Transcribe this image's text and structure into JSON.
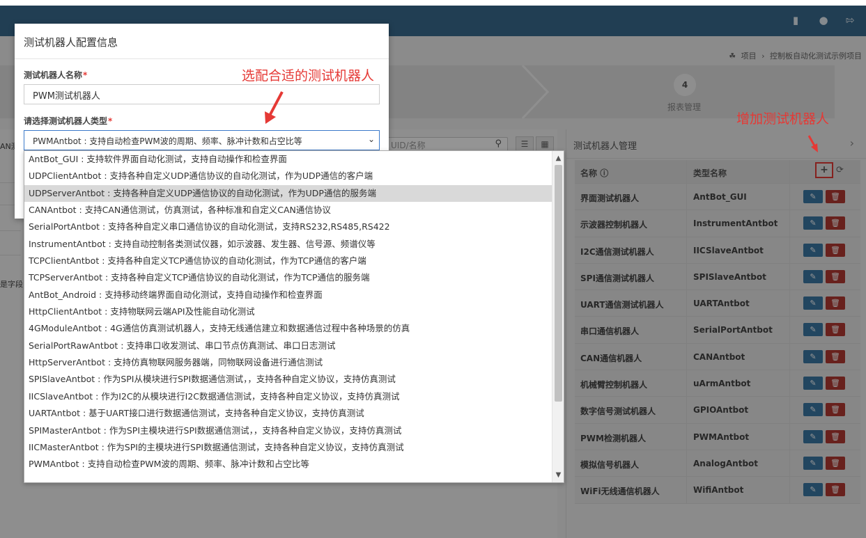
{
  "colors": {
    "topbar": "#3a6c8f",
    "accent_red": "#e53935",
    "edit_btn": "#3b79a6",
    "delete_btn": "#b33a32",
    "selected_option": "#d9d9d9"
  },
  "topbar": {
    "icons": [
      "file-icon",
      "user-icon",
      "logout-icon"
    ]
  },
  "breadcrumb": {
    "home": "项目",
    "sep": "›",
    "current": "控制板自动化测试示例项目"
  },
  "wizard": {
    "step_number": "4",
    "step_label": "报表管理"
  },
  "left_fragments": {
    "frag1": "AN测",
    "frag2": "是字段"
  },
  "search": {
    "placeholder": "UID/名称"
  },
  "right_panel": {
    "title": "测试机器人管理",
    "header": {
      "name": "名称",
      "type": "类型名称"
    },
    "rows": [
      {
        "name": "界面测试机器人",
        "type": "AntBot_GUI"
      },
      {
        "name": "示波器控制机器人",
        "type": "InstrumentAntbot"
      },
      {
        "name": "I2C通信测试机器人",
        "type": "IICSlaveAntbot"
      },
      {
        "name": "SPI通信测试机器人",
        "type": "SPISlaveAntbot"
      },
      {
        "name": "UART通信测试机器人",
        "type": "UARTAntbot"
      },
      {
        "name": "串口通信机器人",
        "type": "SerialPortAntbot"
      },
      {
        "name": "CAN通信机器人",
        "type": "CANAntbot"
      },
      {
        "name": "机械臂控制机器人",
        "type": "uArmAntbot"
      },
      {
        "name": "数字信号测试机器人",
        "type": "GPIOAntbot"
      },
      {
        "name": "PWM检测机器人",
        "type": "PWMAntbot"
      },
      {
        "name": "模拟信号机器人",
        "type": "AnalogAntbot"
      },
      {
        "name": "WiFi无线通信机器人",
        "type": "WifiAntbot"
      }
    ]
  },
  "modal": {
    "title": "测试机器人配置信息",
    "name_label": "测试机器人名称",
    "name_value": "PWM测试机器人",
    "type_label": "请选择测试机器人类型",
    "required_mark": "*",
    "selected_type": "PWMAntbot : 支持自动检查PWM波的周期、频率、脉冲计数和占空比等"
  },
  "dropdown": {
    "options": [
      "AntBot_GUI : 支持软件界面自动化测试，支持自动操作和检查界面",
      "UDPClientAntbot : 支持各种自定义UDP通信协议的自动化测试，作为UDP通信的客户端",
      "UDPServerAntbot : 支持各种自定义UDP通信协议的自动化测试，作为UDP通信的服务端",
      "CANAntbot : 支持CAN通信测试，仿真测试，各种标准和自定义CAN通信协议",
      "SerialPortAntbot : 支持各种自定义串口通信协议的自动化测试，支持RS232,RS485,RS422",
      "InstrumentAntbot : 支持自动控制各类测试仪器，如示波器、发生器、信号源、频谱仪等",
      "TCPClientAntbot : 支持各种自定义TCP通信协议的自动化测试，作为TCP通信的客户端",
      "TCPServerAntbot : 支持各种自定义TCP通信协议的自动化测试，作为TCP通信的服务端",
      "AntBot_Android : 支持移动终端界面自动化测试，支持自动操作和检查界面",
      "HttpClientAntbot : 支持物联网云端API及性能自动化测试",
      "4GModuleAntbot : 4G通信仿真测试机器人，支持无线通信建立和数据通信过程中各种场景的仿真",
      "SerialPortRawAntbot : 支持串口收发测试、串口节点仿真测试、串口日志测试",
      "HttpServerAntbot : 支持仿真物联网服务器端，同物联网设备进行通信测试",
      "SPISlaveAntbot : 作为SPI从模块进行SPI数据通信测试，，支持各种自定义协议，支持仿真测试",
      "IICSlaveAntbot : 作为I2C的从模块进行I2C数据通信测试，支持各种自定义协议，支持仿真测试",
      "UARTAntbot : 基于UART接口进行数据通信测试，支持各种自定义协议，支持仿真测试",
      "SPIMasterAntbot : 作为SPI主模块进行SPI数据通信测试，，支持各种自定义协议，支持仿真测试",
      "IICMasterAntbot : 作为SPI的主模块进行SPI数据通信测试，支持各种自定义协议，支持仿真测试",
      "PWMAntbot : 支持自动检查PWM波的周期、频率、脉冲计数和占空比等"
    ],
    "highlighted_index": 2
  },
  "annotations": {
    "select_robot": "选配合适的测试机器人",
    "add_robot": "增加测试机器人"
  }
}
